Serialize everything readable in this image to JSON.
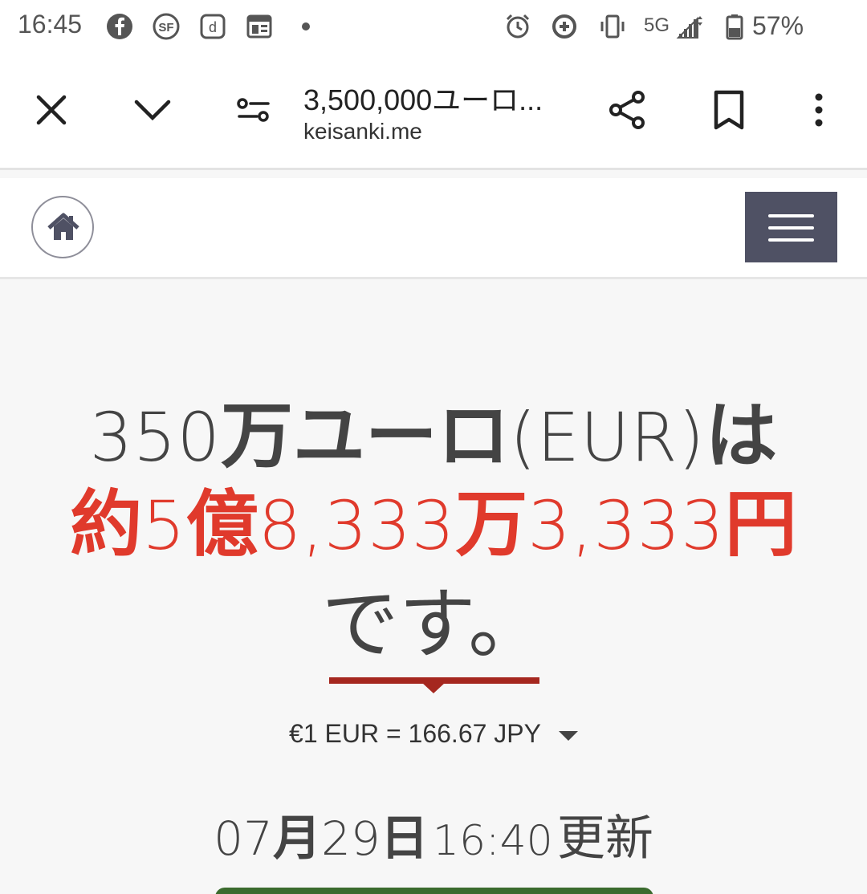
{
  "status_bar": {
    "time": "16:45",
    "network": "5G",
    "battery": "57%",
    "icons": [
      "facebook-icon",
      "sf-app-icon",
      "d-app-icon",
      "news-icon",
      "dot-icon",
      "alarm-icon",
      "data-saver-icon",
      "vibrate-icon",
      "signal-icon",
      "battery-icon"
    ]
  },
  "toolbar": {
    "title": "3,500,000ユーロ...",
    "url": "keisanki.me",
    "icons": [
      "close-icon",
      "chevron-down-icon",
      "site-settings-icon",
      "share-icon",
      "bookmark-icon",
      "more-vert-icon"
    ]
  },
  "header": {
    "home_icon": "home-icon",
    "menu_icon": "hamburger-menu-icon",
    "menu_color": "#4f5164"
  },
  "result": {
    "line1_num": "350",
    "line1_kanji": "万ユーロ",
    "line1_code": "(EUR)",
    "line1_tail": "は",
    "line2_approx": "約",
    "line2_num1": "5",
    "line2_unit1": "億",
    "line2_num2": "8,333",
    "line2_unit2": "万",
    "line2_num3": "3,333",
    "line2_unit3": "円",
    "line3": "です。",
    "accent_color": "#e03a2c",
    "underline_color": "#a5271f"
  },
  "rate": {
    "text": "€1 EUR = 166.67 JPY"
  },
  "updated": {
    "month_num": "07",
    "month_kanji": "月",
    "day_num": "29",
    "day_kanji": "日",
    "time": "16:40",
    "label": "更新"
  },
  "footer_button_color": "#3b6b2e"
}
